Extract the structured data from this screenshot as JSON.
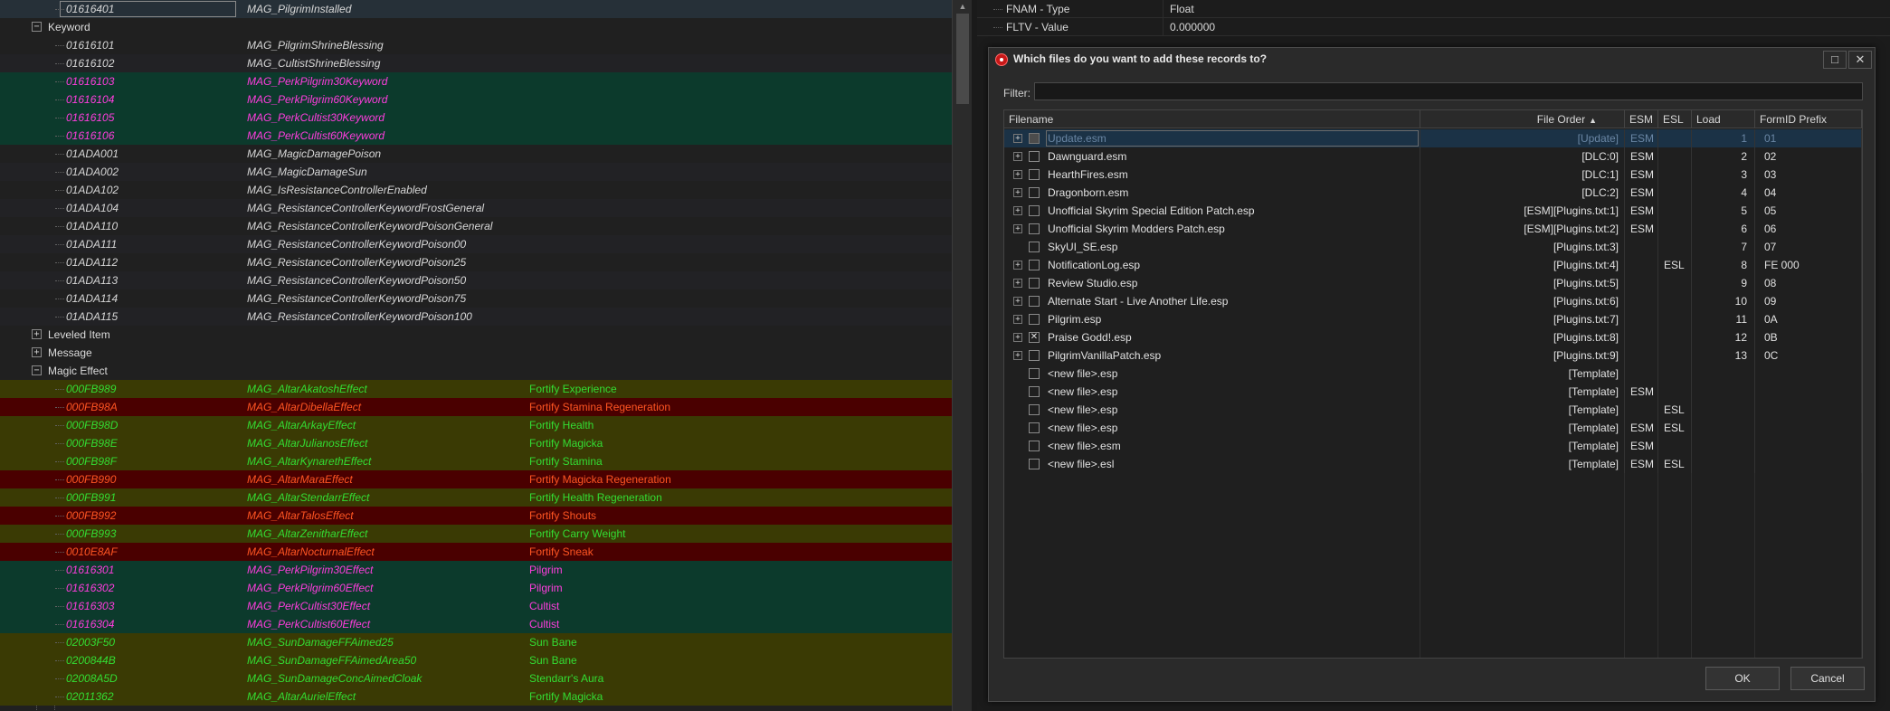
{
  "left_tree": {
    "rows": [
      {
        "kind": "rec",
        "c1": "01616401",
        "c2": "MAG_PilgrimInstalled",
        "c3": "",
        "style": "plain",
        "bg": "sel",
        "selected": true
      },
      {
        "kind": "group",
        "label": "Keyword",
        "expanded": true
      },
      {
        "kind": "rec",
        "c1": "01616101",
        "c2": "MAG_PilgrimShrineBlessing",
        "c3": "",
        "style": "plain",
        "bg": "none"
      },
      {
        "kind": "rec",
        "c1": "01616102",
        "c2": "MAG_CultistShrineBlessing",
        "c3": "",
        "style": "plain",
        "bg": "dark"
      },
      {
        "kind": "rec",
        "c1": "01616103",
        "c2": "MAG_PerkPilgrim30Keyword",
        "c3": "",
        "style": "pink",
        "bg": "teal"
      },
      {
        "kind": "rec",
        "c1": "01616104",
        "c2": "MAG_PerkPilgrim60Keyword",
        "c3": "",
        "style": "pink",
        "bg": "teal"
      },
      {
        "kind": "rec",
        "c1": "01616105",
        "c2": "MAG_PerkCultist30Keyword",
        "c3": "",
        "style": "pink",
        "bg": "teal"
      },
      {
        "kind": "rec",
        "c1": "01616106",
        "c2": "MAG_PerkCultist60Keyword",
        "c3": "",
        "style": "pink",
        "bg": "teal"
      },
      {
        "kind": "rec",
        "c1": "01ADA001",
        "c2": "MAG_MagicDamagePoison",
        "c3": "",
        "style": "plain",
        "bg": "none"
      },
      {
        "kind": "rec",
        "c1": "01ADA002",
        "c2": "MAG_MagicDamageSun",
        "c3": "",
        "style": "plain",
        "bg": "dark"
      },
      {
        "kind": "rec",
        "c1": "01ADA102",
        "c2": "MAG_IsResistanceControllerEnabled",
        "c3": "",
        "style": "plain",
        "bg": "none"
      },
      {
        "kind": "rec",
        "c1": "01ADA104",
        "c2": "MAG_ResistanceControllerKeywordFrostGeneral",
        "c3": "",
        "style": "plain",
        "bg": "dark"
      },
      {
        "kind": "rec",
        "c1": "01ADA110",
        "c2": "MAG_ResistanceControllerKeywordPoisonGeneral",
        "c3": "",
        "style": "plain",
        "bg": "none"
      },
      {
        "kind": "rec",
        "c1": "01ADA111",
        "c2": "MAG_ResistanceControllerKeywordPoison00",
        "c3": "",
        "style": "plain",
        "bg": "dark"
      },
      {
        "kind": "rec",
        "c1": "01ADA112",
        "c2": "MAG_ResistanceControllerKeywordPoison25",
        "c3": "",
        "style": "plain",
        "bg": "none"
      },
      {
        "kind": "rec",
        "c1": "01ADA113",
        "c2": "MAG_ResistanceControllerKeywordPoison50",
        "c3": "",
        "style": "plain",
        "bg": "dark"
      },
      {
        "kind": "rec",
        "c1": "01ADA114",
        "c2": "MAG_ResistanceControllerKeywordPoison75",
        "c3": "",
        "style": "plain",
        "bg": "none"
      },
      {
        "kind": "rec",
        "c1": "01ADA115",
        "c2": "MAG_ResistanceControllerKeywordPoison100",
        "c3": "",
        "style": "plain",
        "bg": "dark"
      },
      {
        "kind": "group",
        "label": "Leveled Item",
        "expanded": false
      },
      {
        "kind": "group",
        "label": "Message",
        "expanded": false
      },
      {
        "kind": "group",
        "label": "Magic Effect",
        "expanded": true
      },
      {
        "kind": "rec",
        "c1": "000FB989",
        "c2": "MAG_AltarAkatoshEffect",
        "c3": "Fortify Experience",
        "style": "green",
        "bg": "olive"
      },
      {
        "kind": "rec",
        "c1": "000FB98A",
        "c2": "MAG_AltarDibellaEffect",
        "c3": "Fortify Stamina Regeneration",
        "style": "red",
        "bg": "maroon"
      },
      {
        "kind": "rec",
        "c1": "000FB98D",
        "c2": "MAG_AltarArkayEffect",
        "c3": "Fortify Health",
        "style": "green",
        "bg": "olive"
      },
      {
        "kind": "rec",
        "c1": "000FB98E",
        "c2": "MAG_AltarJulianosEffect",
        "c3": "Fortify Magicka",
        "style": "green",
        "bg": "olive"
      },
      {
        "kind": "rec",
        "c1": "000FB98F",
        "c2": "MAG_AltarKynarethEffect",
        "c3": "Fortify Stamina",
        "style": "green",
        "bg": "olive"
      },
      {
        "kind": "rec",
        "c1": "000FB990",
        "c2": "MAG_AltarMaraEffect",
        "c3": "Fortify Magicka Regeneration",
        "style": "red",
        "bg": "maroon"
      },
      {
        "kind": "rec",
        "c1": "000FB991",
        "c2": "MAG_AltarStendarrEffect",
        "c3": "Fortify Health Regeneration",
        "style": "green",
        "bg": "olive"
      },
      {
        "kind": "rec",
        "c1": "000FB992",
        "c2": "MAG_AltarTalosEffect",
        "c3": "Fortify Shouts",
        "style": "red",
        "bg": "maroon"
      },
      {
        "kind": "rec",
        "c1": "000FB993",
        "c2": "MAG_AltarZenitharEffect",
        "c3": "Fortify Carry Weight",
        "style": "green",
        "bg": "olive"
      },
      {
        "kind": "rec",
        "c1": "0010E8AF",
        "c2": "MAG_AltarNocturnalEffect",
        "c3": "Fortify Sneak",
        "style": "red",
        "bg": "maroon"
      },
      {
        "kind": "rec",
        "c1": "01616301",
        "c2": "MAG_PerkPilgrim30Effect",
        "c3": "Pilgrim",
        "style": "pink",
        "bg": "teal"
      },
      {
        "kind": "rec",
        "c1": "01616302",
        "c2": "MAG_PerkPilgrim60Effect",
        "c3": "Pilgrim",
        "style": "pink",
        "bg": "teal"
      },
      {
        "kind": "rec",
        "c1": "01616303",
        "c2": "MAG_PerkCultist30Effect",
        "c3": "Cultist",
        "style": "pink",
        "bg": "teal"
      },
      {
        "kind": "rec",
        "c1": "01616304",
        "c2": "MAG_PerkCultist60Effect",
        "c3": "Cultist",
        "style": "pink",
        "bg": "teal"
      },
      {
        "kind": "rec",
        "c1": "02003F50",
        "c2": "MAG_SunDamageFFAimed25",
        "c3": "Sun Bane",
        "style": "green",
        "bg": "olive"
      },
      {
        "kind": "rec",
        "c1": "0200844B",
        "c2": "MAG_SunDamageFFAimedArea50",
        "c3": "Sun Bane",
        "style": "green",
        "bg": "olive"
      },
      {
        "kind": "rec",
        "c1": "02008A5D",
        "c2": "MAG_SunDamageConcAimedCloak",
        "c3": "Stendarr's Aura",
        "style": "green",
        "bg": "olive"
      },
      {
        "kind": "rec",
        "c1": "02011362",
        "c2": "MAG_AltarAurielEffect",
        "c3": "Fortify Magicka",
        "style": "green",
        "bg": "olive"
      }
    ]
  },
  "right_panel": {
    "rows": [
      {
        "key": "FNAM - Type",
        "value": "Float"
      },
      {
        "key": "FLTV - Value",
        "value": "0.000000"
      }
    ]
  },
  "dialog": {
    "title": "Which files do you want to add these records to?",
    "maximize_glyph": "□",
    "close_glyph": "✕",
    "filter_label": "Filter:",
    "filter_value": "",
    "columns": [
      "Filename",
      "File Order",
      "ESM",
      "ESL",
      "Load Order",
      "FormID Prefix"
    ],
    "sort_glyph": "▲",
    "rows": [
      {
        "name": "Update.esm",
        "order": "[Update]",
        "esm": "ESM",
        "esl": "",
        "lo": "1",
        "fid": "01",
        "checked": false,
        "expandable": true,
        "selected": true
      },
      {
        "name": "Dawnguard.esm",
        "order": "[DLC:0]",
        "esm": "ESM",
        "esl": "",
        "lo": "2",
        "fid": "02",
        "checked": false,
        "expandable": true,
        "selected": false
      },
      {
        "name": "HearthFires.esm",
        "order": "[DLC:1]",
        "esm": "ESM",
        "esl": "",
        "lo": "3",
        "fid": "03",
        "checked": false,
        "expandable": true,
        "selected": false
      },
      {
        "name": "Dragonborn.esm",
        "order": "[DLC:2]",
        "esm": "ESM",
        "esl": "",
        "lo": "4",
        "fid": "04",
        "checked": false,
        "expandable": true,
        "selected": false
      },
      {
        "name": "Unofficial Skyrim Special Edition Patch.esp",
        "order": "[ESM][Plugins.txt:1]",
        "esm": "ESM",
        "esl": "",
        "lo": "5",
        "fid": "05",
        "checked": false,
        "expandable": true,
        "selected": false
      },
      {
        "name": "Unofficial Skyrim Modders Patch.esp",
        "order": "[ESM][Plugins.txt:2]",
        "esm": "ESM",
        "esl": "",
        "lo": "6",
        "fid": "06",
        "checked": false,
        "expandable": true,
        "selected": false
      },
      {
        "name": "SkyUI_SE.esp",
        "order": "[Plugins.txt:3]",
        "esm": "",
        "esl": "",
        "lo": "7",
        "fid": "07",
        "checked": false,
        "expandable": false,
        "selected": false
      },
      {
        "name": "NotificationLog.esp",
        "order": "[Plugins.txt:4]",
        "esm": "",
        "esl": "ESL",
        "lo": "8",
        "fid": "FE 000",
        "checked": false,
        "expandable": true,
        "selected": false
      },
      {
        "name": "Review Studio.esp",
        "order": "[Plugins.txt:5]",
        "esm": "",
        "esl": "",
        "lo": "9",
        "fid": "08",
        "checked": false,
        "expandable": true,
        "selected": false
      },
      {
        "name": "Alternate Start - Live Another Life.esp",
        "order": "[Plugins.txt:6]",
        "esm": "",
        "esl": "",
        "lo": "10",
        "fid": "09",
        "checked": false,
        "expandable": true,
        "selected": false
      },
      {
        "name": "Pilgrim.esp",
        "order": "[Plugins.txt:7]",
        "esm": "",
        "esl": "",
        "lo": "11",
        "fid": "0A",
        "checked": false,
        "expandable": true,
        "selected": false
      },
      {
        "name": "Praise Godd!.esp",
        "order": "[Plugins.txt:8]",
        "esm": "",
        "esl": "",
        "lo": "12",
        "fid": "0B",
        "checked": true,
        "expandable": true,
        "selected": false
      },
      {
        "name": "PilgrimVanillaPatch.esp",
        "order": "[Plugins.txt:9]",
        "esm": "",
        "esl": "",
        "lo": "13",
        "fid": "0C",
        "checked": false,
        "expandable": true,
        "selected": false
      },
      {
        "name": "<new file>.esp",
        "order": "[Template]",
        "esm": "",
        "esl": "",
        "lo": "",
        "fid": "",
        "checked": false,
        "expandable": false,
        "selected": false
      },
      {
        "name": "<new file>.esp",
        "order": "[Template]",
        "esm": "ESM",
        "esl": "",
        "lo": "",
        "fid": "",
        "checked": false,
        "expandable": false,
        "selected": false
      },
      {
        "name": "<new file>.esp",
        "order": "[Template]",
        "esm": "",
        "esl": "ESL",
        "lo": "",
        "fid": "",
        "checked": false,
        "expandable": false,
        "selected": false
      },
      {
        "name": "<new file>.esp",
        "order": "[Template]",
        "esm": "ESM",
        "esl": "ESL",
        "lo": "",
        "fid": "",
        "checked": false,
        "expandable": false,
        "selected": false
      },
      {
        "name": "<new file>.esm",
        "order": "[Template]",
        "esm": "ESM",
        "esl": "",
        "lo": "",
        "fid": "",
        "checked": false,
        "expandable": false,
        "selected": false
      },
      {
        "name": "<new file>.esl",
        "order": "[Template]",
        "esm": "ESM",
        "esl": "ESL",
        "lo": "",
        "fid": "",
        "checked": false,
        "expandable": false,
        "selected": false
      }
    ],
    "ok_label": "OK",
    "cancel_label": "Cancel"
  }
}
